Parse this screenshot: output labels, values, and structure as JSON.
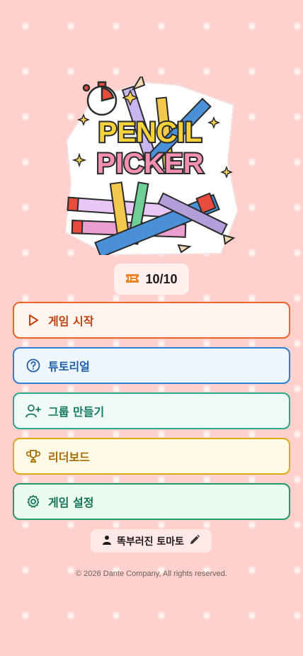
{
  "app": {
    "logo_line1": "PENCIL",
    "logo_line2": "PICKER"
  },
  "tickets": {
    "count": "10/10",
    "icon": "ticket-icon",
    "color": "#e8862a"
  },
  "menu": {
    "start": {
      "label": "게임 시작",
      "icon": "play-icon",
      "color": "#e8652a"
    },
    "tutorial": {
      "label": "튜토리얼",
      "icon": "question-circle-icon",
      "color": "#2f7fd6"
    },
    "group": {
      "label": "그룹 만들기",
      "icon": "user-plus-icon",
      "color": "#2aa88a"
    },
    "leaderboard": {
      "label": "리더보드",
      "icon": "trophy-icon",
      "color": "#e0a81c"
    },
    "settings": {
      "label": "게임 설정",
      "icon": "gear-icon",
      "color": "#21996a"
    }
  },
  "user": {
    "nickname": "똑부러진 토마토",
    "icon": "person-icon",
    "edit_icon": "pencil-icon"
  },
  "footer": {
    "copyright": "© 2026 Dante Company, All rights reserved."
  }
}
